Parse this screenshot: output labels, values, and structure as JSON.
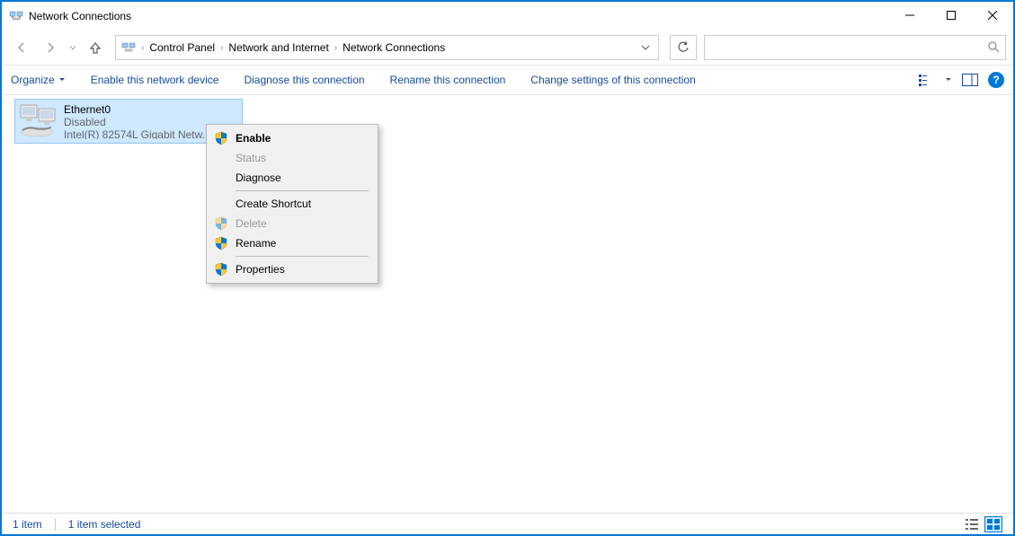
{
  "window": {
    "title": "Network Connections"
  },
  "breadcrumb": {
    "items": [
      "Control Panel",
      "Network and Internet",
      "Network Connections"
    ]
  },
  "search": {
    "placeholder": ""
  },
  "commands": {
    "organize": "Organize",
    "enable": "Enable this network device",
    "diagnose": "Diagnose this connection",
    "rename": "Rename this connection",
    "change": "Change settings of this connection"
  },
  "connection": {
    "name": "Ethernet0",
    "status": "Disabled",
    "device": "Intel(R) 82574L Gigabit Netw..."
  },
  "contextmenu": {
    "enable": "Enable",
    "status": "Status",
    "diagnose": "Diagnose",
    "shortcut": "Create Shortcut",
    "delete": "Delete",
    "rename": "Rename",
    "properties": "Properties"
  },
  "statusbar": {
    "count": "1 item",
    "selected": "1 item selected"
  }
}
